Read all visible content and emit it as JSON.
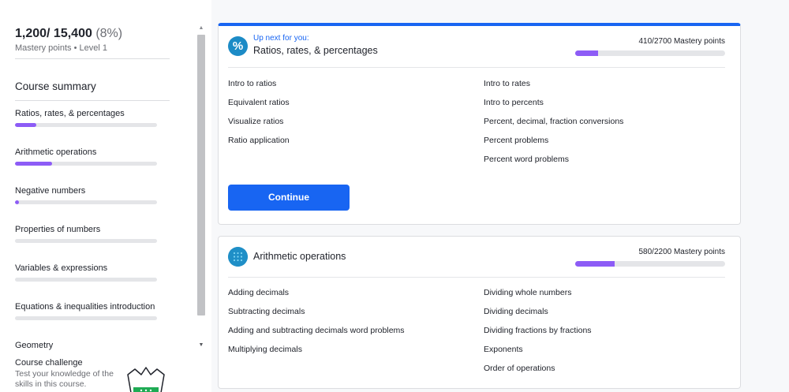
{
  "mastery": {
    "points": "1,200/ 15,400",
    "percent": "(8%)",
    "subtitle": "Mastery points • Level 1",
    "fraction": 0.078
  },
  "sidebar": {
    "summary_title": "Course summary",
    "units": [
      {
        "label": "Ratios, rates, & percentages",
        "progress": 0.15
      },
      {
        "label": "Arithmetic operations",
        "progress": 0.26
      },
      {
        "label": "Negative numbers",
        "progress": 0.03
      },
      {
        "label": "Properties of numbers",
        "progress": 0
      },
      {
        "label": "Variables & expressions",
        "progress": 0
      },
      {
        "label": "Equations & inequalities introduction",
        "progress": 0
      },
      {
        "label": "Geometry",
        "progress": 0
      }
    ],
    "challenge": {
      "title": "Course challenge",
      "text": "Test your knowledge of the skills in this course."
    }
  },
  "card1": {
    "upnext": "Up next for you:",
    "title": "Ratios, rates, & percentages",
    "points": "410/2700 Mastery points",
    "progress": 0.152,
    "lessons_left": [
      "Intro to ratios",
      "Equivalent ratios",
      "Visualize ratios",
      "Ratio application"
    ],
    "lessons_right": [
      "Intro to rates",
      "Intro to percents",
      "Percent, decimal, fraction conversions",
      "Percent problems",
      "Percent word problems"
    ],
    "continue_label": "Continue",
    "icon": "percent-icon",
    "icon_glyph": "%"
  },
  "card2": {
    "title": "Arithmetic operations",
    "points": "580/2200 Mastery points",
    "progress": 0.264,
    "lessons_left": [
      "Adding decimals",
      "Subtracting decimals",
      "Adding and subtracting decimals word problems",
      "Multiplying decimals"
    ],
    "lessons_right": [
      "Dividing whole numbers",
      "Dividing decimals",
      "Dividing fractions by fractions",
      "Exponents",
      "Order of operations"
    ],
    "icon": "arithmetic-icon"
  },
  "colors": {
    "accent": "#1865f2",
    "progress": "#8d5cf6",
    "track": "#e4e5e8"
  }
}
